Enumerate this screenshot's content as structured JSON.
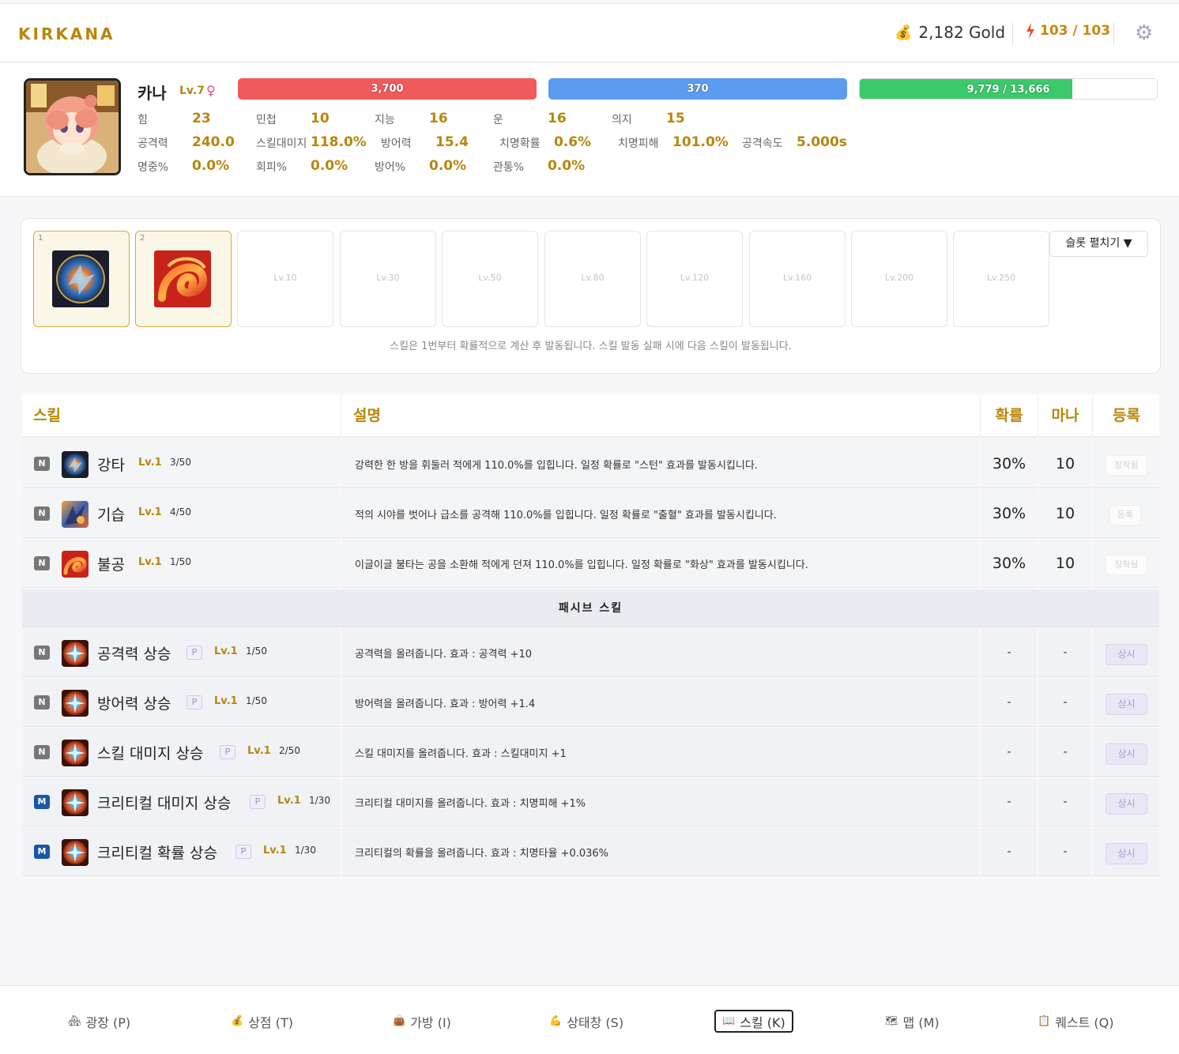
{
  "header": {
    "brand": "KIRKANA",
    "gold_text": "2,182 Gold",
    "energy_text": "103 / 103"
  },
  "character": {
    "name": "카나",
    "level": "Lv.7",
    "gender": "♀",
    "hp": {
      "text": "3,700",
      "fill_pct": 100,
      "color": "#f05a5a"
    },
    "mp": {
      "text": "370",
      "fill_pct": 100,
      "color": "#5b9bf0"
    },
    "exp": {
      "text": "9,779 / 13,666",
      "fill_pct": 71.6,
      "color": "#3cc96b"
    },
    "stats": [
      {
        "label": "힘",
        "value": "23"
      },
      {
        "label": "민첩",
        "value": "10"
      },
      {
        "label": "지능",
        "value": "16"
      },
      {
        "label": "운",
        "value": "16"
      },
      {
        "label": "의지",
        "value": "15"
      },
      {
        "label": "공격력",
        "value": "240.0"
      },
      {
        "label": "스킬대미지",
        "value": "118.0%"
      },
      {
        "label": "방어력",
        "value": "15.4"
      },
      {
        "label": "치명확률",
        "value": "0.6%"
      },
      {
        "label": "치명피해",
        "value": "101.0%"
      },
      {
        "label": "공격속도",
        "value": "5.000s"
      },
      {
        "label": "명중%",
        "value": "0.0%"
      },
      {
        "label": "회피%",
        "value": "0.0%"
      },
      {
        "label": "방어%",
        "value": "0.0%"
      },
      {
        "label": "관통%",
        "value": "0.0%"
      }
    ]
  },
  "slots": {
    "items": [
      {
        "num": "1",
        "icon": "strike-icon"
      },
      {
        "num": "2",
        "icon": "fireball-icon"
      },
      {
        "req": "Lv.10"
      },
      {
        "req": "Lv.30"
      },
      {
        "req": "Lv.50"
      },
      {
        "req": "Lv.80"
      },
      {
        "req": "Lv.120"
      },
      {
        "req": "Lv.160"
      },
      {
        "req": "Lv.200"
      },
      {
        "req": "Lv.250"
      }
    ],
    "expand_label": "슬롯 펼치기 ▼",
    "note": "스킬은 1번부터 확률적으로 계산 후 발동됩니다. 스킬 발동 실패 시에 다음 스킬이 발동됩니다."
  },
  "table": {
    "headers": {
      "skill": "스킬",
      "desc": "설명",
      "chance": "확률",
      "mana": "마나",
      "register": "등록"
    },
    "active": [
      {
        "grade": "N",
        "name": "강타",
        "level": "Lv.1",
        "count": "3/50",
        "desc": "강력한 한 방을 휘둘러 적에게 110.0%를 입힙니다. 일정 확률로 \"스턴\" 효과를 발동시킵니다.",
        "chance": "30%",
        "mana": "10",
        "action": "장착됨"
      },
      {
        "grade": "N",
        "name": "기습",
        "level": "Lv.1",
        "count": "4/50",
        "desc": "적의 시야를 벗어나 급소를 공격해 110.0%를 입힙니다. 일정 확률로 \"출혈\" 효과를 발동시킵니다.",
        "chance": "30%",
        "mana": "10",
        "action": "등록"
      },
      {
        "grade": "N",
        "name": "불공",
        "level": "Lv.1",
        "count": "1/50",
        "desc": "이글이글 불타는 공을 소환해 적에게 던져 110.0%를 입힙니다. 일정 확률로 \"화상\" 효과를 발동시킵니다.",
        "chance": "30%",
        "mana": "10",
        "action": "장착됨"
      }
    ],
    "passive_title": "패시브 스킬",
    "passive": [
      {
        "grade": "N",
        "name": "공격력 상승",
        "badge": "P",
        "level": "Lv.1",
        "count": "1/50",
        "desc": "공격력을 올려줍니다. 효과 : 공격력 +10",
        "chance": "-",
        "mana": "-",
        "action": "상시"
      },
      {
        "grade": "N",
        "name": "방어력 상승",
        "badge": "P",
        "level": "Lv.1",
        "count": "1/50",
        "desc": "방어력을 올려줍니다. 효과 : 방어력 +1.4",
        "chance": "-",
        "mana": "-",
        "action": "상시"
      },
      {
        "grade": "N",
        "name": "스킬 대미지 상승",
        "badge": "P",
        "level": "Lv.1",
        "count": "2/50",
        "desc": "스킬 대미지를 올려줍니다. 효과 : 스킬대미지 +1",
        "chance": "-",
        "mana": "-",
        "action": "상시"
      },
      {
        "grade": "M",
        "name": "크리티컬 대미지 상승",
        "badge": "P",
        "level": "Lv.1",
        "count": "1/30",
        "desc": "크리티컬 대미지를 올려줍니다. 효과 : 치명피해 +1%",
        "chance": "-",
        "mana": "-",
        "action": "상시"
      },
      {
        "grade": "M",
        "name": "크리티컬 확률 상승",
        "badge": "P",
        "level": "Lv.1",
        "count": "1/30",
        "desc": "크리티컬의 확률을 올려줍니다. 효과 : 치명타율 +0.036%",
        "chance": "-",
        "mana": "-",
        "action": "상시"
      }
    ]
  },
  "nav": [
    {
      "label": "광장 (P)",
      "icon": "plaza-icon"
    },
    {
      "label": "상점 (T)",
      "icon": "moneybag-icon"
    },
    {
      "label": "가방 (I)",
      "icon": "bag-icon"
    },
    {
      "label": "상태창 (S)",
      "icon": "muscle-icon"
    },
    {
      "label": "스킬 (K)",
      "icon": "book-icon",
      "active": true
    },
    {
      "label": "맵 (M)",
      "icon": "map-icon"
    },
    {
      "label": "퀘스트 (Q)",
      "icon": "clipboard-icon"
    }
  ]
}
